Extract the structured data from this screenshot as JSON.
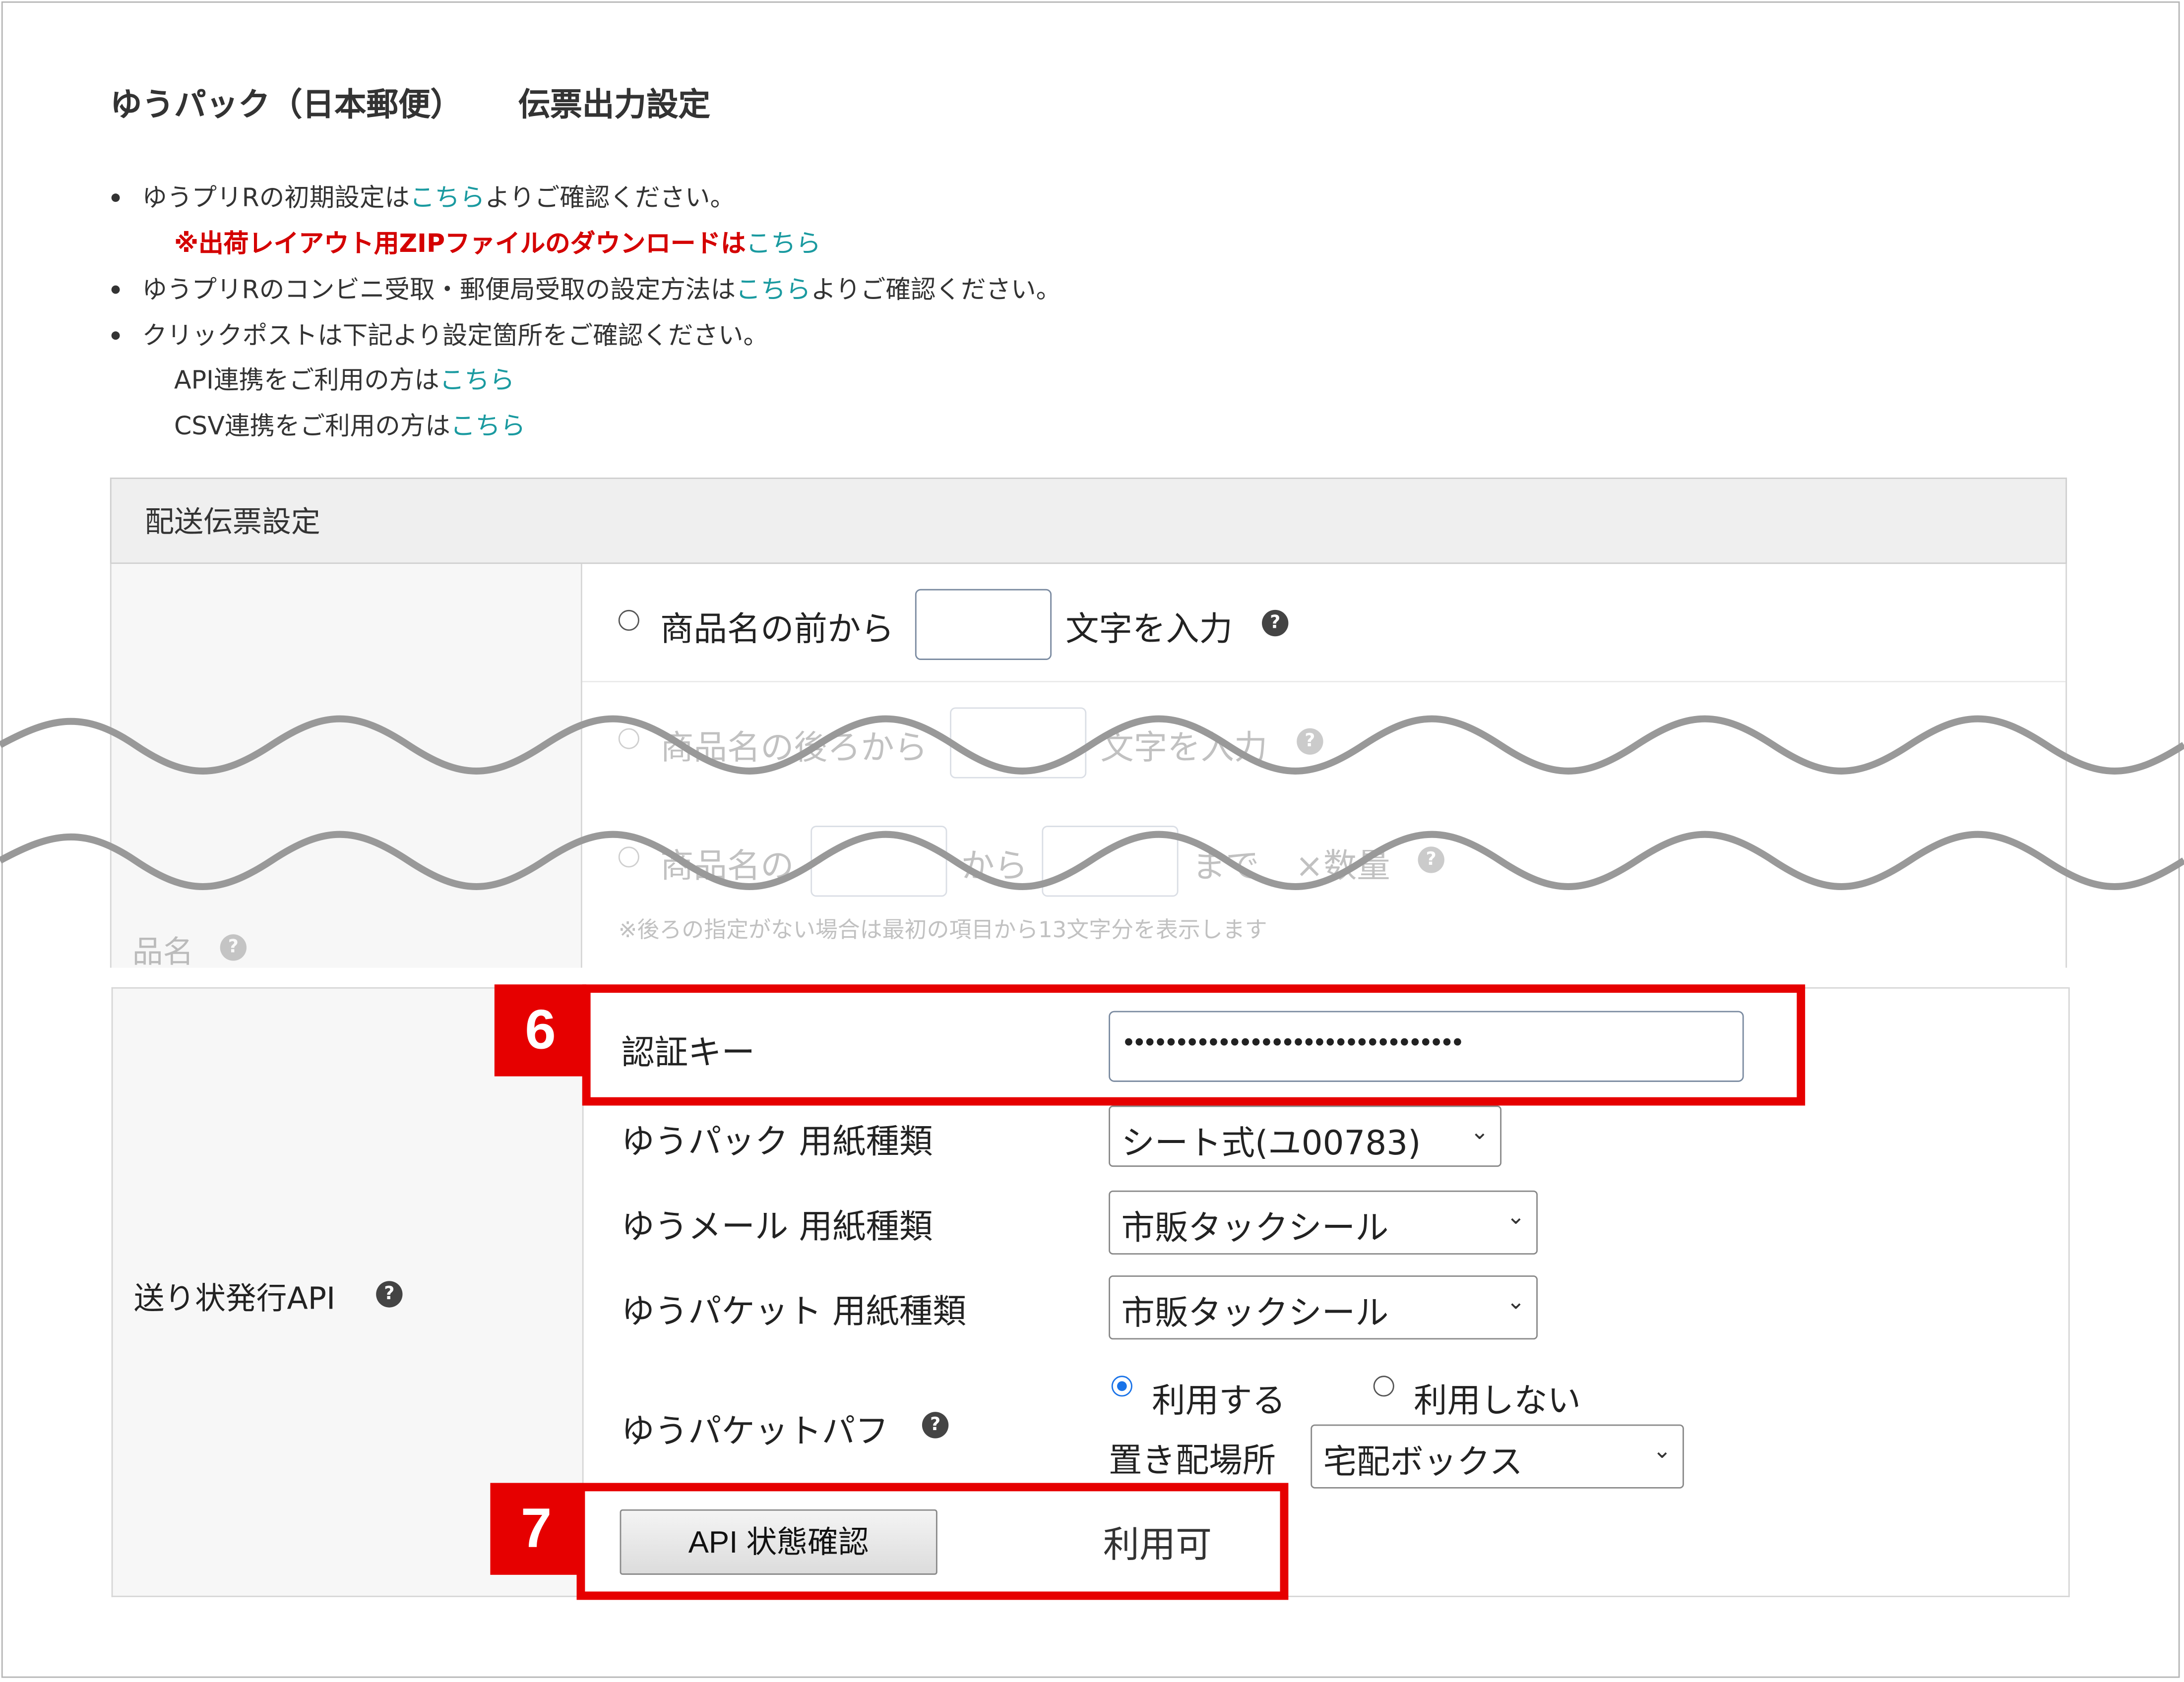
{
  "header": {
    "title_main": "ゆうパック（日本郵便）",
    "title_sub": "伝票出力設定"
  },
  "notes": {
    "n1_pre": "ゆうプリRの初期設定は",
    "n1_link": "こちら",
    "n1_post": "よりご確認ください。",
    "n1b_red": "※出荷レイアウト用ZIPファイルのダウンロードは",
    "n1b_link": "こちら",
    "n2_pre": "ゆうプリRのコンビニ受取・郵便局受取の設定方法は",
    "n2_link": "こちら",
    "n2_post": "よりご確認ください。",
    "n3": "クリックポストは下記より設定箇所をご確認ください。",
    "n3a_pre": "API連携をご利用の方は",
    "n3a_link": "こちら",
    "n3b_pre": "CSV連携をご利用の方は",
    "n3b_link": "こちら"
  },
  "panel": {
    "title": "配送伝票設定"
  },
  "product_name": {
    "label": "品名",
    "opt1_pre": "商品名の前から",
    "opt1_post": "文字を入力",
    "opt2_pre": "商品名の後ろから",
    "opt2_post": "文字を入力",
    "opt3_pre": "商品名の",
    "opt3_mid": "から",
    "opt3_post1": "まで",
    "opt3_post2": "×数量",
    "hint": "※後ろの指定がない場合は最初の項目から13文字分を表示します"
  },
  "api": {
    "label": "送り状発行API",
    "auth_key_label": "認証キー",
    "auth_key_value": "••••••••••••••••••••••••••••••••",
    "yupack_paper_label": "ゆうパック 用紙種類",
    "yupack_paper_value": "シート式(ユ00783)",
    "yumail_paper_label": "ゆうメール 用紙種類",
    "yumail_paper_value": "市販タックシール",
    "yupacket_paper_label": "ゆうパケット 用紙種類",
    "yupacket_paper_value": "市販タックシール",
    "puff_label": "ゆうパケットパフ",
    "puff_use": "利用する",
    "puff_nouse": "利用しない",
    "placement_label": "置き配場所",
    "placement_value": "宅配ボックス",
    "status_button": "API 状態確認",
    "status_value": "利用可"
  },
  "callouts": {
    "badge6": "6",
    "badge7": "7"
  },
  "colors": {
    "highlight": "#e60000",
    "link": "#1a9aa0",
    "warning_text": "#d40000"
  }
}
